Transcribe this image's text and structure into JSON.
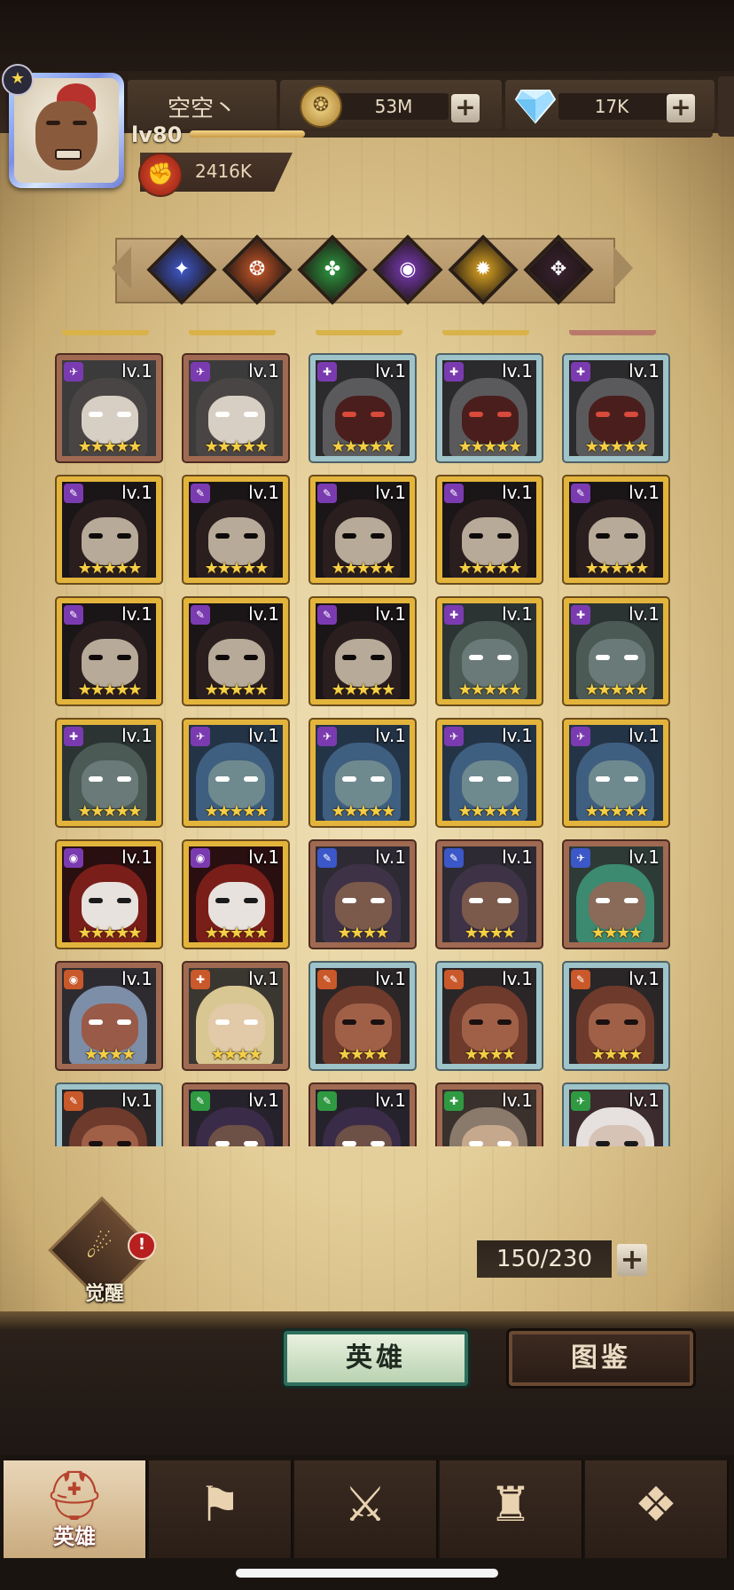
{
  "player": {
    "name": "空空丶",
    "level": "lv80",
    "level_progress": 0.22,
    "power": "2416K"
  },
  "resources": {
    "gold": "53M",
    "gems": "17K"
  },
  "factions": [
    {
      "id": "faction-1",
      "color": "#3f57c8",
      "icon": "✦"
    },
    {
      "id": "faction-2",
      "color": "#c9582a",
      "icon": "❂"
    },
    {
      "id": "faction-3",
      "color": "#2f9a42",
      "icon": "✤"
    },
    {
      "id": "faction-4",
      "color": "#7c3bb8",
      "icon": "◉"
    },
    {
      "id": "faction-5",
      "color": "#e0a824",
      "icon": "✹"
    },
    {
      "id": "faction-6",
      "color": "#3a2231",
      "icon": "✥"
    }
  ],
  "top_strip_colors": [
    "#d9b24a",
    "#d9b24a",
    "#d9b24a",
    "#d9b24a",
    "#b9796a"
  ],
  "heroes": [
    {
      "frame": "bronze",
      "class_color": "#7b3bb0",
      "class_icon": "✈",
      "lv": "lv.1",
      "stars": "★★★★★",
      "art": "girl-bald"
    },
    {
      "frame": "bronze",
      "class_color": "#7b3bb0",
      "class_icon": "✈",
      "lv": "lv.1",
      "stars": "★★★★★",
      "art": "girl-bald"
    },
    {
      "frame": "silver",
      "class_color": "#7b3bb0",
      "class_icon": "✚",
      "lv": "lv.1",
      "stars": "★★★★★",
      "art": "hooded-red"
    },
    {
      "frame": "silver",
      "class_color": "#7b3bb0",
      "class_icon": "✚",
      "lv": "lv.1",
      "stars": "★★★★★",
      "art": "hooded-red"
    },
    {
      "frame": "silver",
      "class_color": "#7b3bb0",
      "class_icon": "✚",
      "lv": "lv.1",
      "stars": "★★★★★",
      "art": "hooded-red"
    },
    {
      "frame": "gold",
      "class_color": "#7b3bb0",
      "class_icon": "✎",
      "lv": "lv.1",
      "stars": "★★★★★",
      "art": "plague"
    },
    {
      "frame": "gold",
      "class_color": "#7b3bb0",
      "class_icon": "✎",
      "lv": "lv.1",
      "stars": "★★★★★",
      "art": "plague"
    },
    {
      "frame": "gold",
      "class_color": "#7b3bb0",
      "class_icon": "✎",
      "lv": "lv.1",
      "stars": "★★★★★",
      "art": "plague"
    },
    {
      "frame": "gold",
      "class_color": "#7b3bb0",
      "class_icon": "✎",
      "lv": "lv.1",
      "stars": "★★★★★",
      "art": "plague"
    },
    {
      "frame": "gold",
      "class_color": "#7b3bb0",
      "class_icon": "✎",
      "lv": "lv.1",
      "stars": "★★★★★",
      "art": "plague"
    },
    {
      "frame": "gold",
      "class_color": "#7b3bb0",
      "class_icon": "✎",
      "lv": "lv.1",
      "stars": "★★★★★",
      "art": "plague"
    },
    {
      "frame": "gold",
      "class_color": "#7b3bb0",
      "class_icon": "✎",
      "lv": "lv.1",
      "stars": "★★★★★",
      "art": "plague"
    },
    {
      "frame": "gold",
      "class_color": "#7b3bb0",
      "class_icon": "✎",
      "lv": "lv.1",
      "stars": "★★★★★",
      "art": "plague"
    },
    {
      "frame": "gold",
      "class_color": "#7b3bb0",
      "class_icon": "✚",
      "lv": "lv.1",
      "stars": "★★★★★",
      "art": "thorn"
    },
    {
      "frame": "gold",
      "class_color": "#7b3bb0",
      "class_icon": "✚",
      "lv": "lv.1",
      "stars": "★★★★★",
      "art": "thorn"
    },
    {
      "frame": "gold",
      "class_color": "#7b3bb0",
      "class_icon": "✚",
      "lv": "lv.1",
      "stars": "★★★★★",
      "art": "thorn"
    },
    {
      "frame": "gold",
      "class_color": "#7b3bb0",
      "class_icon": "✈",
      "lv": "lv.1",
      "stars": "★★★★★",
      "art": "blue-hair"
    },
    {
      "frame": "gold",
      "class_color": "#7b3bb0",
      "class_icon": "✈",
      "lv": "lv.1",
      "stars": "★★★★★",
      "art": "blue-hair"
    },
    {
      "frame": "gold",
      "class_color": "#7b3bb0",
      "class_icon": "✈",
      "lv": "lv.1",
      "stars": "★★★★★",
      "art": "blue-hair"
    },
    {
      "frame": "gold",
      "class_color": "#7b3bb0",
      "class_icon": "✈",
      "lv": "lv.1",
      "stars": "★★★★★",
      "art": "blue-hair"
    },
    {
      "frame": "gold",
      "class_color": "#7b3bb0",
      "class_icon": "◉",
      "lv": "lv.1",
      "stars": "★★★★★",
      "art": "bandage"
    },
    {
      "frame": "gold",
      "class_color": "#7b3bb0",
      "class_icon": "◉",
      "lv": "lv.1",
      "stars": "★★★★★",
      "art": "bandage"
    },
    {
      "frame": "bronze",
      "class_color": "#3b57c8",
      "class_icon": "✎",
      "lv": "lv.1",
      "stars": "★★★★",
      "art": "rogue"
    },
    {
      "frame": "bronze",
      "class_color": "#3b57c8",
      "class_icon": "✎",
      "lv": "lv.1",
      "stars": "★★★★",
      "art": "rogue"
    },
    {
      "frame": "bronze",
      "class_color": "#3b57c8",
      "class_icon": "✈",
      "lv": "lv.1",
      "stars": "★★★★",
      "art": "green-hair"
    },
    {
      "frame": "bronze",
      "class_color": "#c9582a",
      "class_icon": "◉",
      "lv": "lv.1",
      "stars": "★★★★",
      "art": "pirate"
    },
    {
      "frame": "bronze",
      "class_color": "#c9582a",
      "class_icon": "✚",
      "lv": "lv.1",
      "stars": "★★★★",
      "art": "blonde"
    },
    {
      "frame": "silver",
      "class_color": "#c9582a",
      "class_icon": "✎",
      "lv": "lv.1",
      "stars": "★★★★",
      "art": "brute"
    },
    {
      "frame": "silver",
      "class_color": "#c9582a",
      "class_icon": "✎",
      "lv": "lv.1",
      "stars": "★★★★",
      "art": "brute"
    },
    {
      "frame": "silver",
      "class_color": "#c9582a",
      "class_icon": "✎",
      "lv": "lv.1",
      "stars": "★★★★",
      "art": "brute"
    },
    {
      "frame": "silver",
      "class_color": "#c9582a",
      "class_icon": "✎",
      "lv": "lv.1",
      "stars": "",
      "art": "brute"
    },
    {
      "frame": "bronze",
      "class_color": "#2f9a42",
      "class_icon": "✎",
      "lv": "lv.1",
      "stars": "",
      "art": "hood-purple"
    },
    {
      "frame": "bronze",
      "class_color": "#2f9a42",
      "class_icon": "✎",
      "lv": "lv.1",
      "stars": "",
      "art": "hood-purple"
    },
    {
      "frame": "bronze",
      "class_color": "#2f9a42",
      "class_icon": "✚",
      "lv": "lv.1",
      "stars": "",
      "art": "old-man"
    },
    {
      "frame": "silver",
      "class_color": "#2f9a42",
      "class_icon": "✈",
      "lv": "lv.1",
      "stars": "",
      "art": "white-hair"
    }
  ],
  "awaken": {
    "label": "觉醒",
    "alert": "!"
  },
  "roster": {
    "count": "150/230"
  },
  "tabs": {
    "heroes": "英雄",
    "codex": "图鉴"
  },
  "nav": [
    {
      "label": "英雄",
      "icon": "helmet-icon",
      "glyph": "⛑",
      "active": true
    },
    {
      "label": "",
      "icon": "flag-icon",
      "glyph": "⚑",
      "active": false
    },
    {
      "label": "",
      "icon": "crossed-swords-icon",
      "glyph": "⚔",
      "active": false
    },
    {
      "label": "",
      "icon": "castle-icon",
      "glyph": "♜",
      "active": false
    },
    {
      "label": "",
      "icon": "guild-icon",
      "glyph": "❖",
      "active": false
    }
  ]
}
